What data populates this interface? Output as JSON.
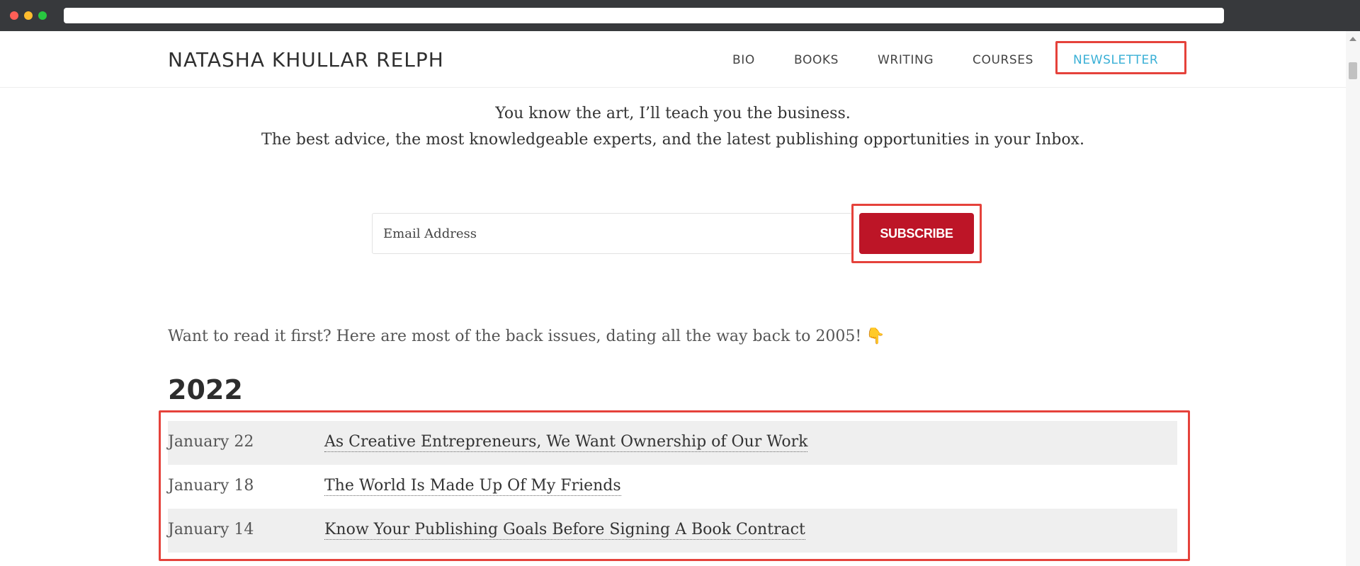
{
  "site": {
    "title": "NATASHA KHULLAR RELPH",
    "nav": [
      "BIO",
      "BOOKS",
      "WRITING",
      "COURSES",
      "NEWSLETTER"
    ],
    "active_nav": "NEWSLETTER"
  },
  "intro": {
    "line1": "You know the art, I’ll teach you the business.",
    "line2": "The best advice, the most knowledgeable experts, and the latest publishing opportunities in your Inbox."
  },
  "form": {
    "email_placeholder": "Email Address",
    "subscribe_label": "SUBSCRIBE"
  },
  "back_issues": {
    "text": "Want to read it first? Here are most of the back issues, dating all the way back to 2005!",
    "emoji": "👇",
    "year": "2022",
    "items": [
      {
        "date": "January 22",
        "title": "As Creative Entrepreneurs, We Want Ownership of Our Work"
      },
      {
        "date": "January 18",
        "title": "The World Is Made Up Of My Friends"
      },
      {
        "date": "January 14",
        "title": "Know Your Publishing Goals Before Signing A Book Contract"
      }
    ]
  },
  "colors": {
    "accent": "#3ab0d6",
    "subscribe_bg": "#bd1527",
    "highlight": "#e5423b",
    "row_shade": "#efefef"
  }
}
